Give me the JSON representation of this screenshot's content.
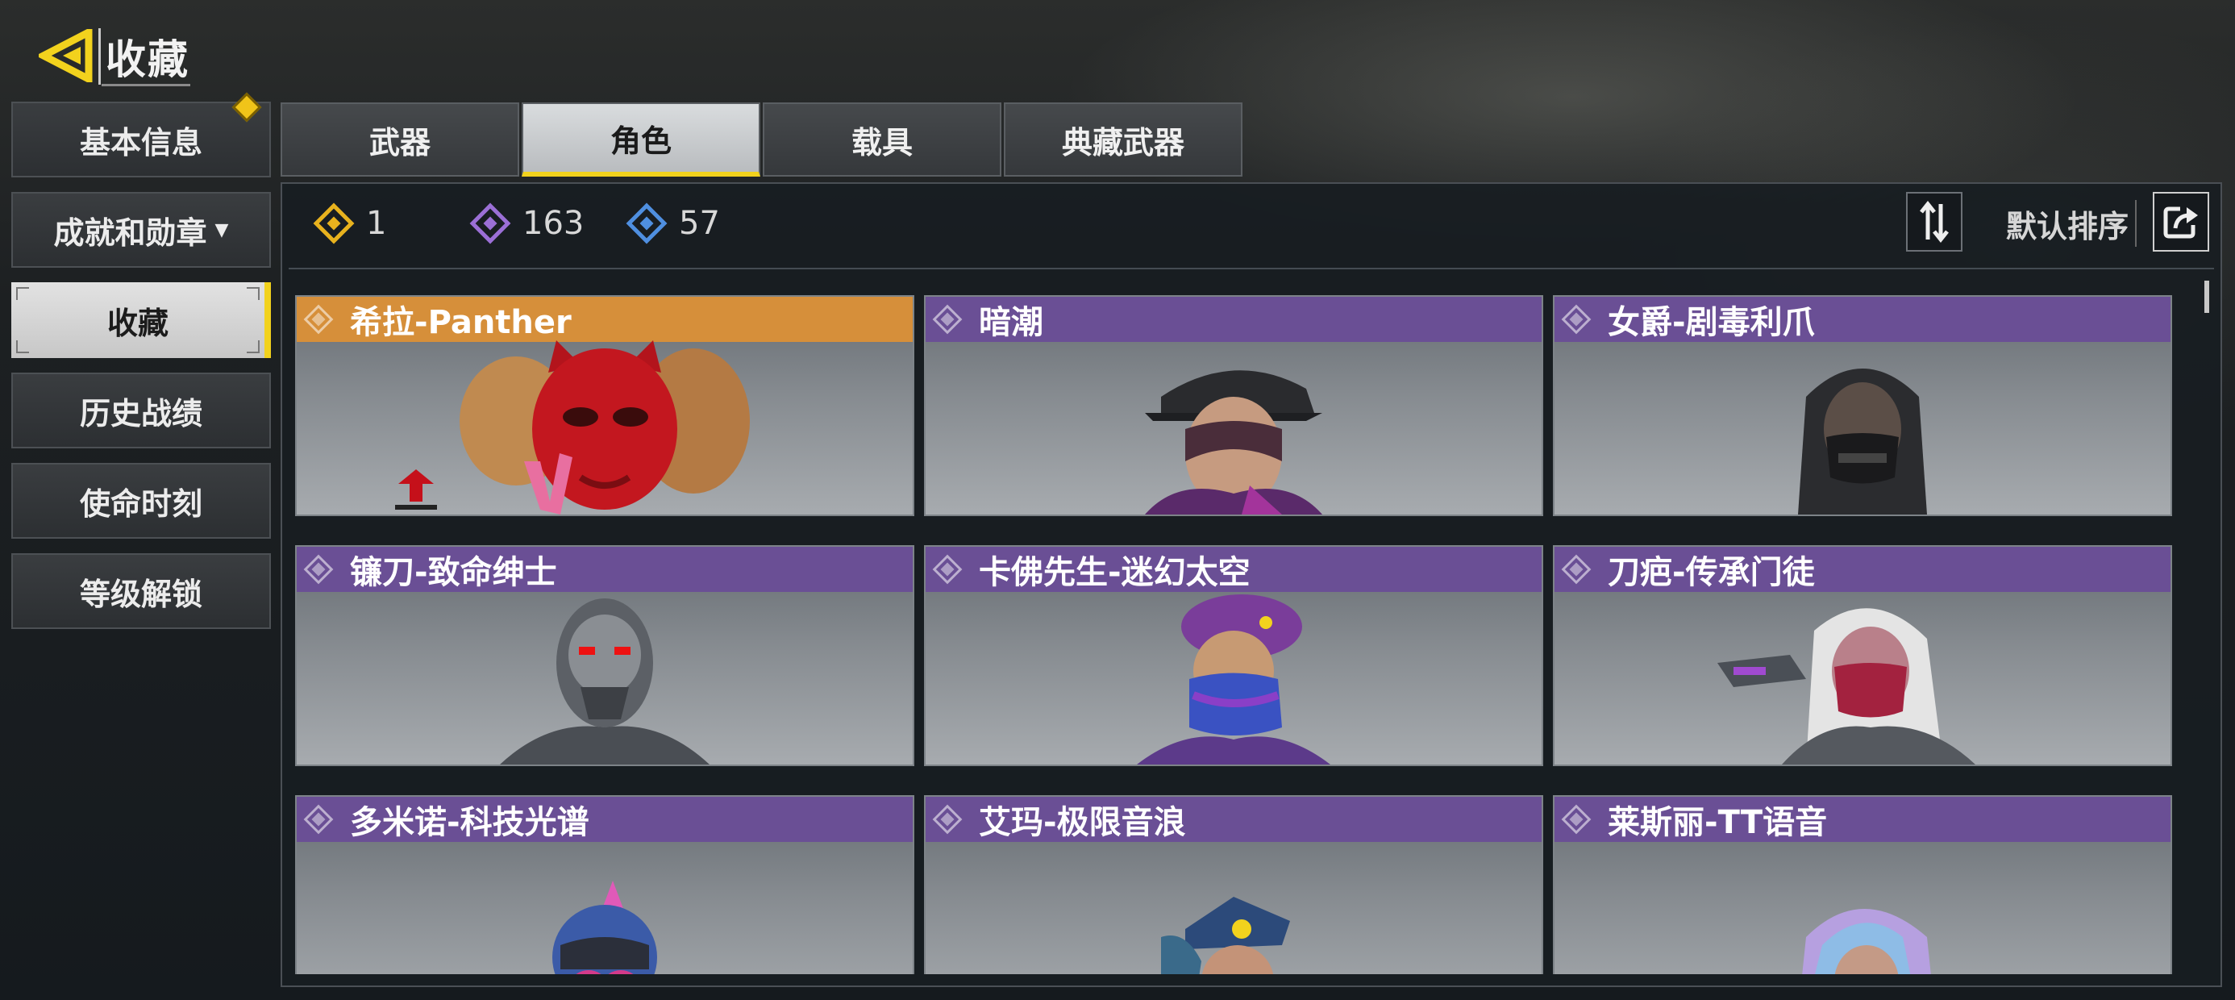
{
  "header": {
    "title": "收藏"
  },
  "sidebar": {
    "items": [
      {
        "label": "基本信息",
        "has_badge": true
      },
      {
        "label": "成就和勋章",
        "dropdown": true
      },
      {
        "label": "收藏",
        "active": true
      },
      {
        "label": "历史战绩"
      },
      {
        "label": "使命时刻"
      },
      {
        "label": "等级解锁"
      }
    ]
  },
  "tabs": [
    {
      "label": "武器"
    },
    {
      "label": "角色",
      "active": true
    },
    {
      "label": "载具"
    },
    {
      "label": "典藏武器"
    }
  ],
  "currency": [
    {
      "icon": "legendary-diamond-icon",
      "color": "#e8b21e",
      "value": "1"
    },
    {
      "icon": "epic-diamond-icon",
      "color": "#9b6fd6",
      "value": "163"
    },
    {
      "icon": "rare-diamond-icon",
      "color": "#4f8fe0",
      "value": "57"
    }
  ],
  "sort": {
    "label": "默认排序"
  },
  "cards": [
    {
      "name": "希拉-Panther",
      "rarity": "legendary"
    },
    {
      "name": "暗潮",
      "rarity": "epic"
    },
    {
      "name": "女爵-剧毒利爪",
      "rarity": "epic"
    },
    {
      "name": "镰刀-致命绅士",
      "rarity": "epic"
    },
    {
      "name": "卡佛先生-迷幻太空",
      "rarity": "epic"
    },
    {
      "name": "刀疤-传承门徒",
      "rarity": "epic"
    },
    {
      "name": "多米诺-科技光谱",
      "rarity": "epic"
    },
    {
      "name": "艾玛-极限音浪",
      "rarity": "epic"
    },
    {
      "name": "莱斯丽-TT语音",
      "rarity": "epic"
    }
  ],
  "colors": {
    "accent": "#f2d21d",
    "epic": "#6a4f95",
    "legendary": "#d68f3a"
  }
}
